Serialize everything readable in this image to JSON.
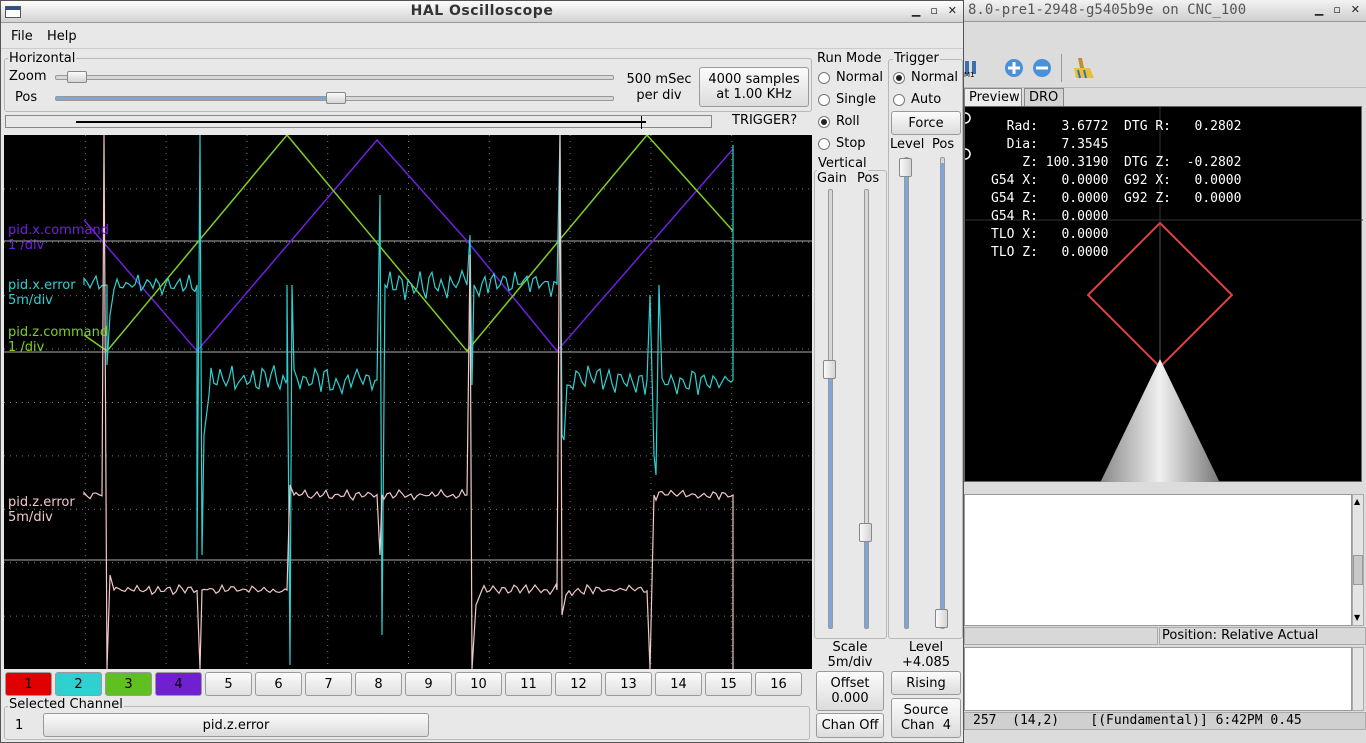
{
  "scope": {
    "title": "HAL Oscilloscope",
    "menu": {
      "file": "File",
      "help": "Help"
    },
    "horizontal": {
      "label": "Horizontal",
      "zoom_label": "Zoom",
      "pos_label": "Pos",
      "zoom_level": 0.02,
      "pos_level": 0.5,
      "time_line1": "500 mSec",
      "time_line2": "per div",
      "samples_line1": "4000 samples",
      "samples_line2": "at 1.00 KHz"
    },
    "trigger_status": "TRIGGER?",
    "run_mode": {
      "label": "Run Mode",
      "options": [
        "Normal",
        "Single",
        "Roll",
        "Stop"
      ],
      "selected": "Roll"
    },
    "trigger": {
      "label": "Trigger",
      "options": [
        "Normal",
        "Auto"
      ],
      "selected": "Normal",
      "force_label": "Force",
      "level_label": "Level",
      "pos_label": "Pos",
      "level_value_label": "Level",
      "level_value": "+4.085",
      "edge": "Rising",
      "source_line1": "Source",
      "source_line2": "Chan  4"
    },
    "vertical": {
      "label": "Vertical",
      "gain_label": "Gain",
      "pos_label": "Pos",
      "scale_label": "Scale",
      "scale_value": "5m/div",
      "offset_label": "Offset",
      "offset_value": "0.000",
      "chan_off": "Chan Off"
    },
    "channels_on_plot": [
      {
        "name": "pid.x.command",
        "scale": "1 /div",
        "color": "#7020e0"
      },
      {
        "name": "pid.x.error",
        "scale": "5m/div",
        "color": "#30d0d0"
      },
      {
        "name": "pid.z.command",
        "scale": "1 /div",
        "color": "#80d020"
      },
      {
        "name": "pid.z.error",
        "scale": "5m/div",
        "color": "#f0c8c8"
      }
    ],
    "channel_buttons": [
      {
        "label": "1",
        "color": "#e00000"
      },
      {
        "label": "2",
        "color": "#30d0d0"
      },
      {
        "label": "3",
        "color": "#60c020"
      },
      {
        "label": "4",
        "color": "#7020d0"
      },
      {
        "label": "5"
      },
      {
        "label": "6"
      },
      {
        "label": "7"
      },
      {
        "label": "8"
      },
      {
        "label": "9"
      },
      {
        "label": "10"
      },
      {
        "label": "11"
      },
      {
        "label": "12"
      },
      {
        "label": "13"
      },
      {
        "label": "14"
      },
      {
        "label": "15"
      },
      {
        "label": "16"
      }
    ],
    "selected_channel": {
      "label": "Selected Channel",
      "number": "1",
      "name": "pid.z.error"
    }
  },
  "axis": {
    "title": "8.0-pre1-2948-g5405b9e on CNC_100",
    "tabs": [
      "Preview",
      "DRO"
    ],
    "active_tab": "Preview",
    "dro_lines": [
      "  Rad:   3.6772  DTG R:   0.2802",
      "  Dia:   7.3545",
      "    Z: 100.3190  DTG Z:  -0.2802",
      "G54 X:   0.0000  G92 X:   0.0000",
      "G54 Z:   0.0000  G92 Z:   0.0000",
      "G54 R:   0.0000",
      "TLO X:   0.0000",
      "TLO Z:   0.0000"
    ],
    "position_label": "Position: Relative Actual",
    "status_line": "257  (14,2)    [(Fundamental)] 6:42PM 0.45"
  }
}
